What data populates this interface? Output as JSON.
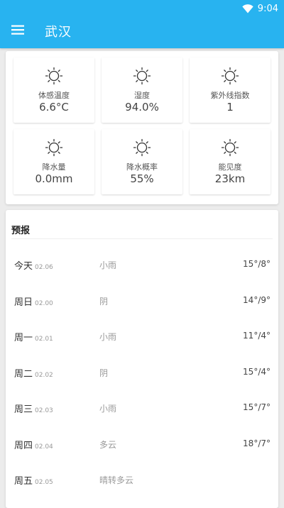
{
  "status_bar": {
    "time": "9:04",
    "icon": "wifi-icon"
  },
  "header": {
    "title": "武汉",
    "menu_icon": "menu-icon",
    "background_color": "#28b3f0"
  },
  "details": [
    {
      "label": "体感温度",
      "value": "6.6°C",
      "icon": "sun-icon"
    },
    {
      "label": "湿度",
      "value": "94.0%",
      "icon": "sun-icon"
    },
    {
      "label": "紫外线指数",
      "value": "1",
      "icon": "sun-icon"
    },
    {
      "label": "降水量",
      "value": "0.0mm",
      "icon": "sun-icon"
    },
    {
      "label": "降水概率",
      "value": "55%",
      "icon": "sun-icon"
    },
    {
      "label": "能见度",
      "value": "23km",
      "icon": "sun-icon"
    }
  ],
  "forecast": {
    "title": "预报",
    "rows": [
      {
        "day": "今天",
        "date": "02.06",
        "condition": "小雨",
        "temp": "15°/8°"
      },
      {
        "day": "周日",
        "date": "02.00",
        "condition": "阴",
        "temp": "14°/9°"
      },
      {
        "day": "周一",
        "date": "02.01",
        "condition": "小雨",
        "temp": "11°/4°"
      },
      {
        "day": "周二",
        "date": "02.02",
        "condition": "阴",
        "temp": "15°/4°"
      },
      {
        "day": "周三",
        "date": "02.03",
        "condition": "小雨",
        "temp": "15°/7°"
      },
      {
        "day": "周四",
        "date": "02.04",
        "condition": "多云",
        "temp": "18°/7°"
      },
      {
        "day": "周五",
        "date": "02.05",
        "condition": "晴转多云",
        "temp": ""
      }
    ]
  }
}
